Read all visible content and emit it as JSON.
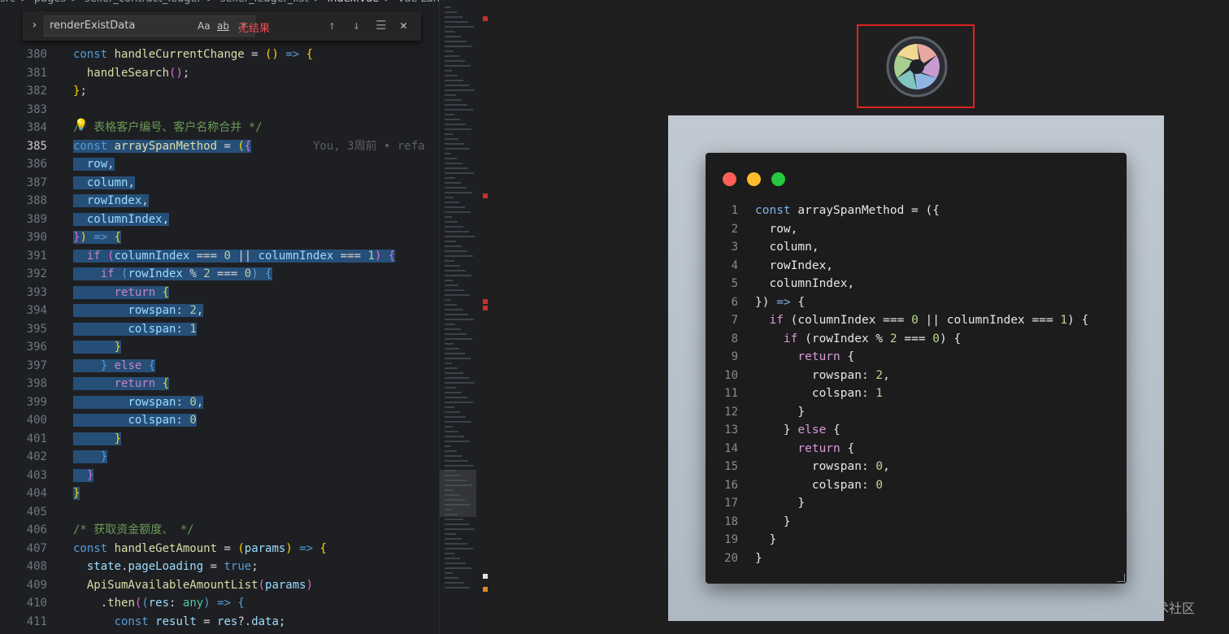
{
  "breadcrumb": [
    "src",
    ">",
    "pages",
    ">",
    "seller_contract_ledger",
    ">",
    "seller_ledger_list",
    ">",
    "index.vue",
    ">",
    "Vue Langu"
  ],
  "find_widget": {
    "query": "renderExistData",
    "case_label": "Aa",
    "word_label": "ab",
    "regex_label": ".*",
    "status": "无结果"
  },
  "blame": "You, 3周前 • refa",
  "editor_lines": [
    {
      "n": "380",
      "html": "<span class=\"k\">const</span> <span class=\"fn\">handleCurrentChange</span> = <span class=\"p\">()</span> <span class=\"k\">=&gt;</span> <span class=\"p\">{</span>"
    },
    {
      "n": "381",
      "html": "  <span class=\"fn\">handleSearch</span><span class=\"p2\">()</span>;"
    },
    {
      "n": "382",
      "html": "<span class=\"p\">}</span>;"
    },
    {
      "n": "383",
      "html": ""
    },
    {
      "n": "384",
      "html": "<span class=\"c\">/* 表格客户编号、客户名称合并 */</span>"
    },
    {
      "n": "385",
      "html": "<span class=\"sel\"><span class=\"k\">const</span> <span class=\"fn\">arraySpanMethod</span> = <span class=\"p\">(</span><span class=\"p2\">{</span></span>"
    },
    {
      "n": "386",
      "html": "<span class=\"sel\">  <span class=\"v\">row</span>,</span>"
    },
    {
      "n": "387",
      "html": "<span class=\"sel\">  <span class=\"v\">column</span>,</span>"
    },
    {
      "n": "388",
      "html": "<span class=\"sel\">  <span class=\"v\">rowIndex</span>,</span>"
    },
    {
      "n": "389",
      "html": "<span class=\"sel\">  <span class=\"v\">columnIndex</span>,</span>"
    },
    {
      "n": "390",
      "html": "<span class=\"sel\"><span class=\"p2\">}</span><span class=\"p\">)</span> <span class=\"k\">=&gt;</span> <span class=\"p\">{</span></span>"
    },
    {
      "n": "391",
      "html": "<span class=\"sel\">  <span class=\"kw\">if</span> <span class=\"p2\">(</span><span class=\"v\">columnIndex</span> === <span class=\"n\">0</span> || <span class=\"v\">columnIndex</span> === <span class=\"n\">1</span><span class=\"p2\">)</span> <span class=\"p2\">{</span></span>"
    },
    {
      "n": "392",
      "html": "<span class=\"sel\">    <span class=\"kw\">if</span> <span class=\"k\">(</span><span class=\"v\">rowIndex</span> % <span class=\"n\">2</span> === <span class=\"n\">0</span><span class=\"k\">)</span> <span class=\"k\">{</span></span>"
    },
    {
      "n": "393",
      "html": "<span class=\"sel\">      <span class=\"kw\">return</span> <span class=\"p\">{</span></span>"
    },
    {
      "n": "394",
      "html": "<span class=\"sel\">        <span class=\"v\">rowspan</span>: <span class=\"n\">2</span>,</span>"
    },
    {
      "n": "395",
      "html": "<span class=\"sel\">        <span class=\"v\">colspan</span>: <span class=\"n\">1</span></span>"
    },
    {
      "n": "396",
      "html": "<span class=\"sel\">      <span class=\"p\">}</span></span>"
    },
    {
      "n": "397",
      "html": "<span class=\"sel\">    <span class=\"k\">}</span> <span class=\"kw\">else</span> <span class=\"k\">{</span></span>"
    },
    {
      "n": "398",
      "html": "<span class=\"sel\">      <span class=\"kw\">return</span> <span class=\"p\">{</span></span>"
    },
    {
      "n": "399",
      "html": "<span class=\"sel\">        <span class=\"v\">rowspan</span>: <span class=\"n\">0</span>,</span>"
    },
    {
      "n": "400",
      "html": "<span class=\"sel\">        <span class=\"v\">colspan</span>: <span class=\"n\">0</span></span>"
    },
    {
      "n": "401",
      "html": "<span class=\"sel\">      <span class=\"p\">}</span></span>"
    },
    {
      "n": "402",
      "html": "<span class=\"sel\">    <span class=\"k\">}</span></span>"
    },
    {
      "n": "403",
      "html": "<span class=\"sel\">  <span class=\"p2\">}</span></span>"
    },
    {
      "n": "404",
      "html": "<span class=\"sel\"><span class=\"p\">}</span></span>"
    },
    {
      "n": "405",
      "html": ""
    },
    {
      "n": "406",
      "html": "<span class=\"c\">/* 获取资金额度、 */</span>"
    },
    {
      "n": "407",
      "html": "<span class=\"k\">const</span> <span class=\"fn\">handleGetAmount</span> = <span class=\"p\">(</span><span class=\"v\">params</span><span class=\"p\">)</span> <span class=\"k\">=&gt;</span> <span class=\"p\">{</span>"
    },
    {
      "n": "408",
      "html": "  <span class=\"v\">state</span>.<span class=\"v\">pageLoading</span> = <span class=\"k\">true</span>;"
    },
    {
      "n": "409",
      "html": "  <span class=\"fn\">ApiSumAvailableAmountList</span><span class=\"p2\">(</span><span class=\"v\">params</span><span class=\"p2\">)</span>"
    },
    {
      "n": "410",
      "html": "    .<span class=\"fn\">then</span><span class=\"p2\">(</span><span class=\"k\">(</span><span class=\"v\">res</span>: <span class=\"t\">any</span><span class=\"k\">)</span> <span class=\"k\">=&gt;</span> <span class=\"k\">{</span>"
    },
    {
      "n": "411",
      "html": "      <span class=\"k\">const</span> <span class=\"v\">result</span> = <span class=\"v\">res</span>?.<span class=\"v\">data</span>;"
    }
  ],
  "window_lines": [
    {
      "n": "1",
      "html": "<span class=\"wk\">const</span> arraySpanMethod = ({"
    },
    {
      "n": "2",
      "html": "  row,"
    },
    {
      "n": "3",
      "html": "  column,"
    },
    {
      "n": "4",
      "html": "  rowIndex,"
    },
    {
      "n": "5",
      "html": "  columnIndex,"
    },
    {
      "n": "6",
      "html": "}) <span class=\"wk\">=&gt;</span> {"
    },
    {
      "n": "7",
      "html": "  <span class=\"wkw\">if</span> (columnIndex === <span class=\"wn\">0</span> || columnIndex === <span class=\"wn\">1</span>) {"
    },
    {
      "n": "8",
      "html": "    <span class=\"wkw\">if</span> (rowIndex % <span class=\"wn\">2</span> === <span class=\"wn\">0</span>) {"
    },
    {
      "n": "9",
      "html": "      <span class=\"wkw\">return</span> {"
    },
    {
      "n": "10",
      "html": "        rowspan: <span class=\"wn\">2</span>,"
    },
    {
      "n": "11",
      "html": "        colspan: <span class=\"wn\">1</span>"
    },
    {
      "n": "12",
      "html": "      }"
    },
    {
      "n": "13",
      "html": "    } <span class=\"wkw\">else</span> {"
    },
    {
      "n": "14",
      "html": "      <span class=\"wkw\">return</span> {"
    },
    {
      "n": "15",
      "html": "        rowspan: <span class=\"wn\">0</span>,"
    },
    {
      "n": "16",
      "html": "        colspan: <span class=\"wn\">0</span>"
    },
    {
      "n": "17",
      "html": "      }"
    },
    {
      "n": "18",
      "html": "    }"
    },
    {
      "n": "19",
      "html": "  }"
    },
    {
      "n": "20",
      "html": "}"
    }
  ],
  "watermark": "@稀土掘金技术社区",
  "colors": {
    "selection": "#264f78",
    "highlight_border": "#e0221f",
    "card_bg": "#b5c0ca"
  },
  "icons": [
    "chevron-right-icon",
    "arrow-up-icon",
    "arrow-down-icon",
    "menu-lines-icon",
    "close-icon",
    "lightbulb-icon",
    "aperture-logo-icon"
  ]
}
